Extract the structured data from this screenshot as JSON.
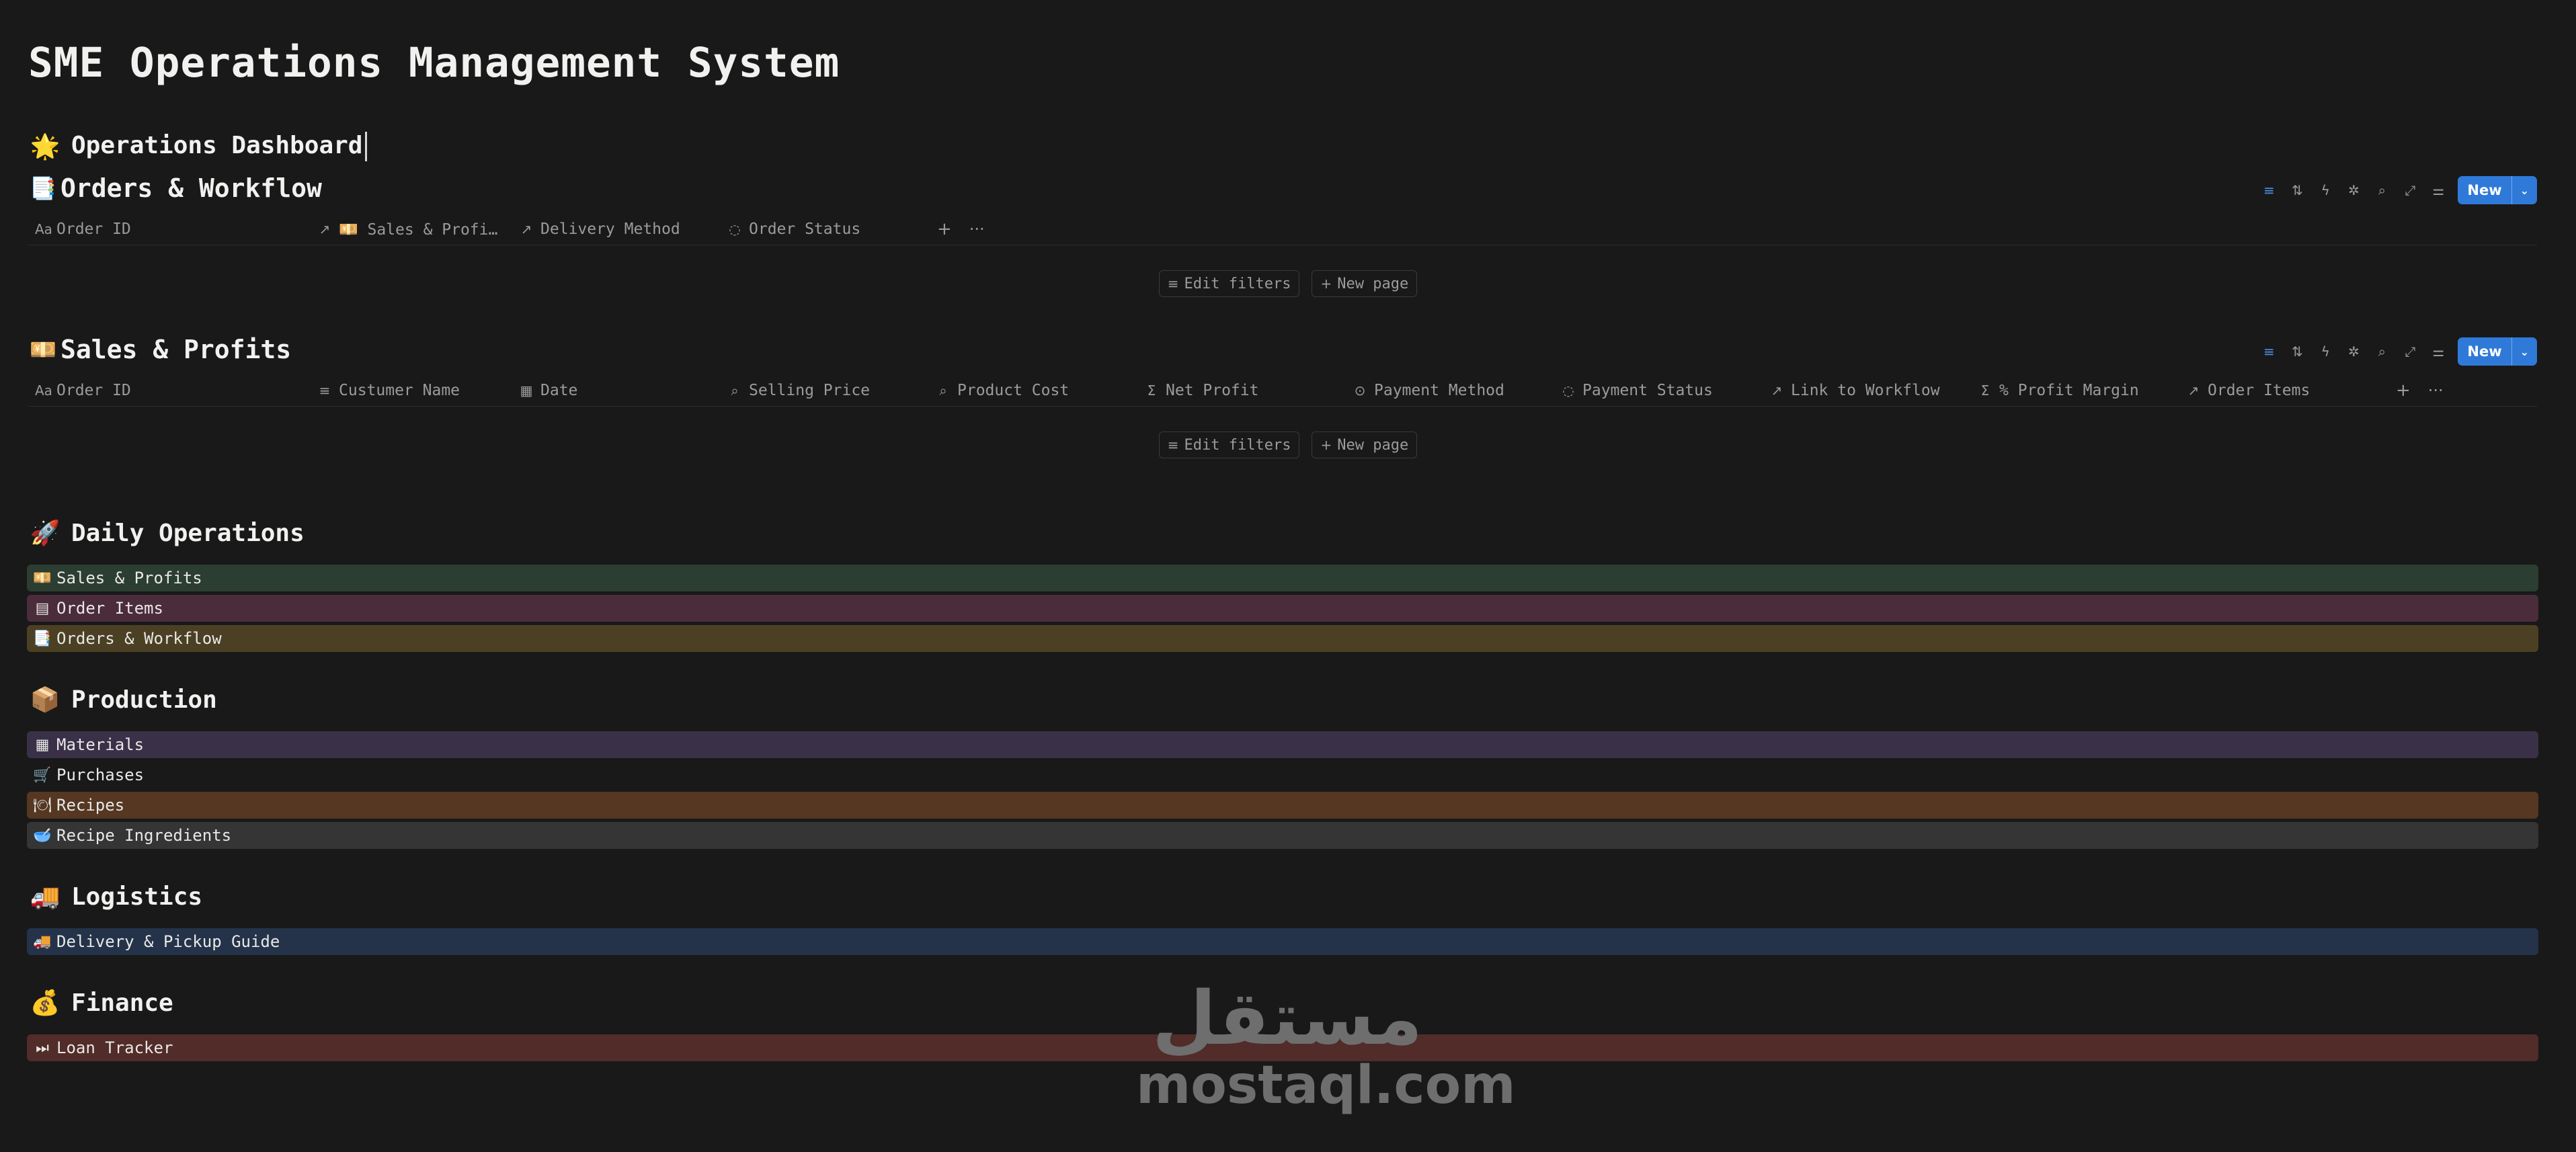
{
  "page_title": "SME Operations Management System",
  "dashboard": {
    "emoji": "🌟",
    "title": "Operations Dashboard"
  },
  "orders_db": {
    "emoji": "📑",
    "title": "Orders & Workflow",
    "columns": [
      {
        "icon": "Aa",
        "label": "Order ID"
      },
      {
        "icon": "↗",
        "label": "💴 Sales & Profi…"
      },
      {
        "icon": "↗",
        "label": "Delivery Method"
      },
      {
        "icon": "◌",
        "label": "Order Status"
      }
    ],
    "add_column": "+",
    "more": "···",
    "edit_filters": "Edit filters",
    "new_page": "New page",
    "new_button": "New"
  },
  "sales_db": {
    "emoji": "💴",
    "title": "Sales & Profits",
    "columns": [
      {
        "icon": "Aa",
        "label": "Order ID"
      },
      {
        "icon": "≡",
        "label": "Custumer Name"
      },
      {
        "icon": "▦",
        "label": "Date"
      },
      {
        "icon": "⌕",
        "label": "Selling Price"
      },
      {
        "icon": "⌕",
        "label": "Product Cost"
      },
      {
        "icon": "Σ",
        "label": "Net Profit"
      },
      {
        "icon": "⊙",
        "label": "Payment Method"
      },
      {
        "icon": "◌",
        "label": "Payment Status"
      },
      {
        "icon": "↗",
        "label": "Link to Workflow"
      },
      {
        "icon": "Σ",
        "label": "% Profit Margin"
      },
      {
        "icon": "↗",
        "label": "Order Items"
      }
    ],
    "add_column": "+",
    "more": "···",
    "edit_filters": "Edit filters",
    "new_page": "New page",
    "new_button": "New"
  },
  "toolbar_icons": [
    "filter-icon",
    "sort-icon",
    "lightning-icon",
    "automation-icon",
    "search-icon",
    "expand-icon",
    "settings-icon"
  ],
  "sections": [
    {
      "emoji": "🚀",
      "title": "Daily Operations",
      "links": [
        {
          "icon": "💴",
          "label": "Sales & Profits",
          "color": "#2c3d31"
        },
        {
          "icon": "▤",
          "label": "Order Items",
          "color": "#4b2c3b"
        },
        {
          "icon": "📑",
          "label": "Orders & Workflow",
          "color": "#4c4024"
        }
      ]
    },
    {
      "emoji": "📦",
      "title": "Production",
      "links": [
        {
          "icon": "▦",
          "label": "Materials",
          "color": "#3a3149"
        },
        {
          "icon": "🛒",
          "label": "Purchases",
          "color": "#191919"
        },
        {
          "icon": "🍽",
          "label": "Recipes",
          "color": "#553722"
        },
        {
          "icon": "🥣",
          "label": "Recipe Ingredients",
          "color": "#353535"
        }
      ]
    },
    {
      "emoji": "🚚",
      "title": "Logistics",
      "links": [
        {
          "icon": "🚚",
          "label": "Delivery & Pickup Guide",
          "color": "#243349"
        }
      ]
    },
    {
      "emoji": "💰",
      "title": "Finance",
      "links": [
        {
          "icon": "⏭",
          "label": "Loan Tracker",
          "color": "#512c28"
        }
      ]
    }
  ],
  "watermark": {
    "arabic": "مستقل",
    "domain": "mostaql.com"
  }
}
